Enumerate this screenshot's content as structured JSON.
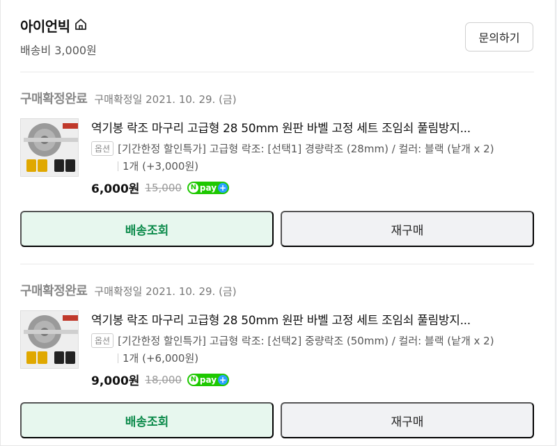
{
  "seller": {
    "name": "아이언빅",
    "shipping": "배송비 3,000원",
    "inquiry_label": "문의하기",
    "icon": "store-home-icon"
  },
  "orders": [
    {
      "status": "구매확정완료",
      "confirm_date": "구매확정일 2021. 10. 29. (금)",
      "title": "역기봉 락조 마구리 고급형 28 50mm 원판 바벨 고정 세트 조임쇠 풀림방지...",
      "option_tag": "옵션",
      "option": "[기간한정 할인특가] 고급형 락조: [선택1] 경량락조 (28mm) / 컬러: 블랙 (낱개 x 2)",
      "quantity": "1개 (+3,000원)",
      "price": "6,000원",
      "original_price": "15,000",
      "npay_label": "pay",
      "track_label": "배송조회",
      "rebuy_label": "재구매"
    },
    {
      "status": "구매확정완료",
      "confirm_date": "구매확정일 2021. 10. 29. (금)",
      "title": "역기봉 락조 마구리 고급형 28 50mm 원판 바벨 고정 세트 조임쇠 풀림방지...",
      "option_tag": "옵션",
      "option": "[기간한정 할인특가] 고급형 락조: [선택2] 중량락조 (50mm) / 컬러: 블랙 (낱개 x 2)",
      "quantity": "1개 (+6,000원)",
      "price": "9,000원",
      "original_price": "18,000",
      "npay_label": "pay",
      "track_label": "배송조회",
      "rebuy_label": "재구매"
    }
  ],
  "colors": {
    "track_bg": "#e7f7ee",
    "track_text": "#0b8a4a",
    "npay_green": "#1ec800"
  }
}
